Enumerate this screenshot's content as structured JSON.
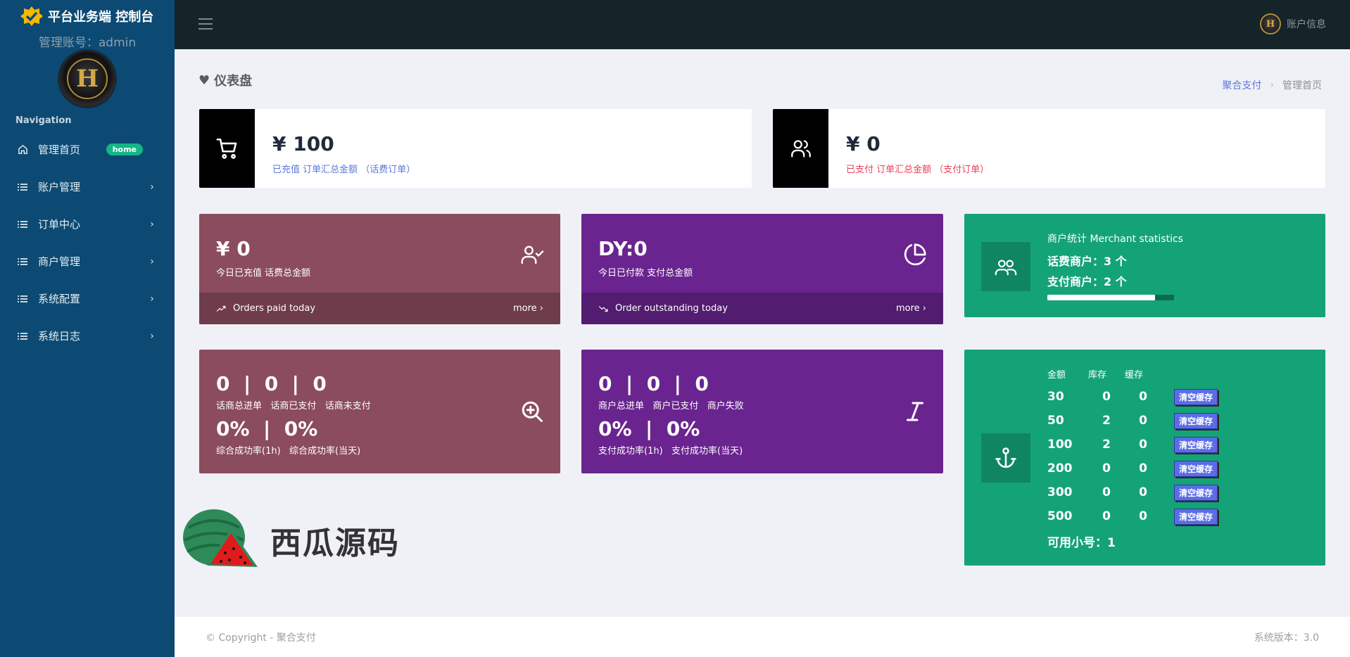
{
  "sidebar": {
    "brand_title": "平台业务端 控制台",
    "admin_line": "管理账号：admin",
    "nav_heading": "Navigation",
    "items": [
      {
        "label": "管理首页",
        "badge": "home",
        "icon": "home-icon"
      },
      {
        "label": "账户管理",
        "icon": "list-icon"
      },
      {
        "label": "订单中心",
        "icon": "list-icon"
      },
      {
        "label": "商户管理",
        "icon": "list-icon"
      },
      {
        "label": "系统配置",
        "icon": "list-icon"
      },
      {
        "label": "系统日志",
        "icon": "list-icon"
      }
    ]
  },
  "topbar": {
    "account_label": "账户信息"
  },
  "page": {
    "title": "仪表盘",
    "breadcrumb": {
      "link": "聚合支付",
      "current": "管理首页"
    }
  },
  "top_cards": [
    {
      "value": "¥ 100",
      "sub": "已充值 订单汇总金额 （话费订单）",
      "sub_color": "#5b79d8",
      "icon": "cart-icon"
    },
    {
      "value": "¥ 0",
      "sub": "已支付 订单汇总金额 （支付订单）",
      "sub_color": "#e8425a",
      "icon": "users-icon"
    }
  ],
  "stat_cards": [
    {
      "value": "¥ 0",
      "label": "今日已充值 话费总金额",
      "footer": "Orders paid today",
      "more": "more",
      "color": "#8b4c5e",
      "foot_color": "#6f3c4b",
      "icon": "user-check-icon"
    },
    {
      "value": "DY:0",
      "label": "今日已付款 支付总金额",
      "footer": "Order outstanding today",
      "more": "more",
      "color": "#6a248f",
      "foot_color": "#521c70",
      "icon": "pie-chart-icon"
    }
  ],
  "merchant_stats": {
    "title": "商户统计 Merchant statistics",
    "phone_merchants": "话费商户：3 个",
    "pay_merchants": "支付商户：2 个",
    "progress": 0.85
  },
  "order_cards": [
    {
      "counts": "0  |  0  |  0",
      "count_labels": "话商总进单   话商已支付   话商未支付",
      "rates": "0%  |  0%",
      "rate_labels": "综合成功率(1h)   综合成功率(当天)",
      "color": "#8b4c5e",
      "icon": "zoom-in-icon"
    },
    {
      "counts": "0  |  0  |  0",
      "count_labels": "商户总进单   商户已支付   商户失败",
      "rates": "0%  |  0%",
      "rate_labels": "支付成功率(1h)   支付成功率(当天)",
      "color": "#6a248f",
      "icon": "italic-icon"
    }
  ],
  "stock": {
    "headers": [
      "金额",
      "库存",
      "缓存"
    ],
    "rows": [
      {
        "amount": "30",
        "stock": "0",
        "cache": "0",
        "action": "清空缓存"
      },
      {
        "amount": "50",
        "stock": "2",
        "cache": "0",
        "action": "清空缓存"
      },
      {
        "amount": "100",
        "stock": "2",
        "cache": "0",
        "action": "清空缓存"
      },
      {
        "amount": "200",
        "stock": "0",
        "cache": "0",
        "action": "清空缓存"
      },
      {
        "amount": "300",
        "stock": "0",
        "cache": "0",
        "action": "清空缓存"
      },
      {
        "amount": "500",
        "stock": "0",
        "cache": "0",
        "action": "清空缓存"
      }
    ],
    "available": "可用小号：1"
  },
  "watermark": {
    "text": "西瓜源码"
  },
  "footer": {
    "copyright": "© Copyright - 聚合支付",
    "version": "系统版本：3.0"
  }
}
